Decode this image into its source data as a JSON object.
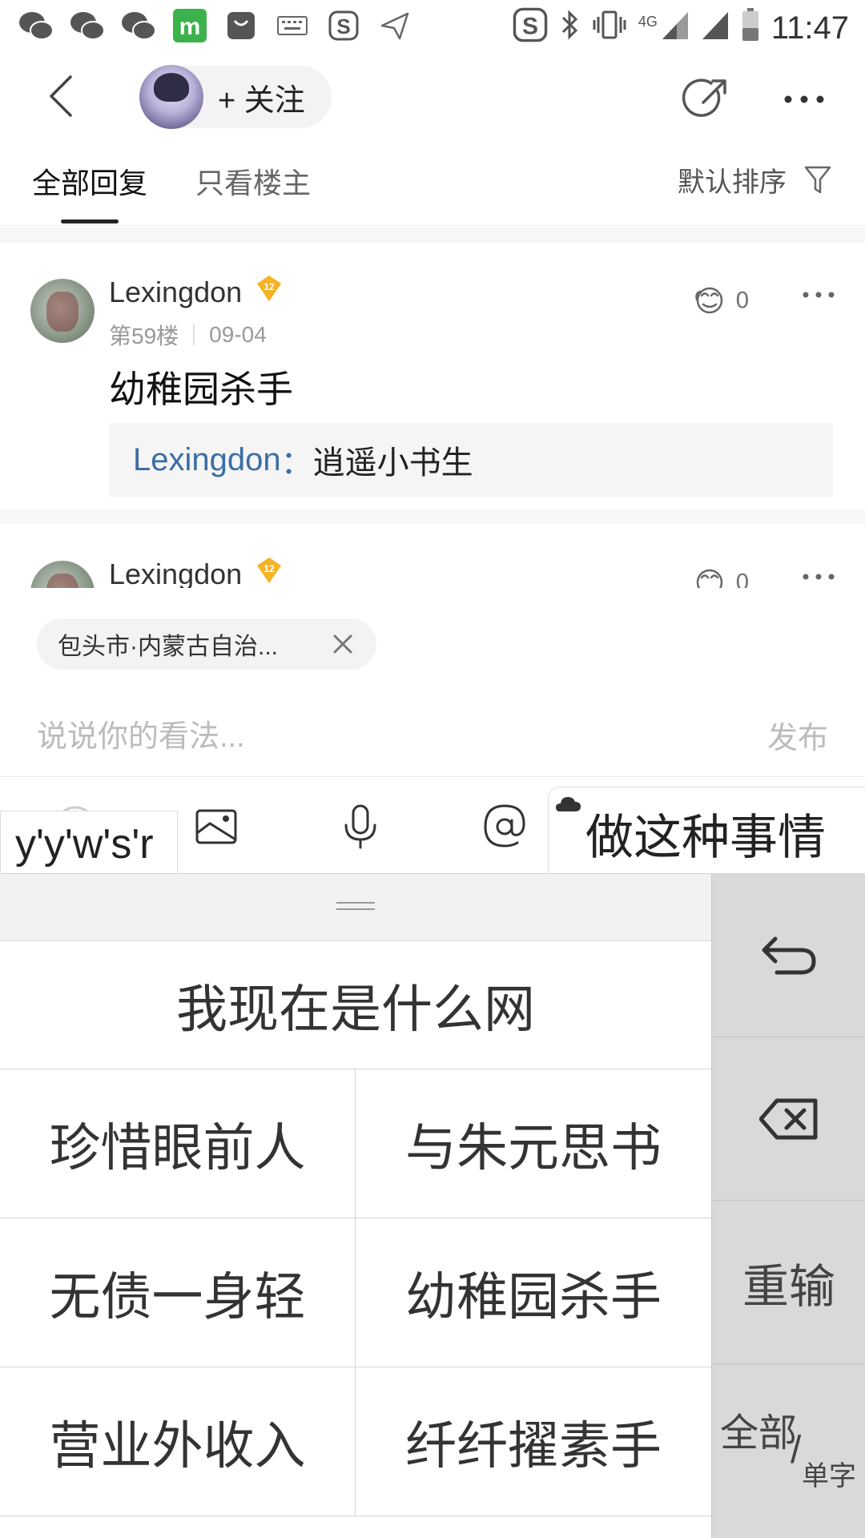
{
  "status_bar": {
    "time": "11:47",
    "network": "4G",
    "icons": [
      "wechat-icon",
      "wechat-icon",
      "wechat-icon",
      "app-m-icon",
      "app-bag-icon",
      "keyboard-icon",
      "sogou-icon",
      "send-icon",
      "sogou-icon",
      "bluetooth-icon",
      "vibrate-icon",
      "signal-icon",
      "signal-icon",
      "battery-icon"
    ]
  },
  "top_nav": {
    "follow_label": "+ 关注"
  },
  "tabs": {
    "all_replies": "全部回复",
    "owner_only": "只看楼主",
    "sort_label": "默认排序"
  },
  "posts": [
    {
      "username": "Lexingdon",
      "level": "12",
      "floor": "第59楼",
      "date": "09-04",
      "likes": "0",
      "content": "幼稚园杀手",
      "quote_author": "Lexingdon",
      "quote_sep": "：",
      "quote_text": "逍遥小书生"
    },
    {
      "username": "Lexingdon",
      "level": "12",
      "likes": "0"
    }
  ],
  "location_chip": {
    "label": "包头市·内蒙古自治..."
  },
  "comment": {
    "placeholder": "说说你的看法...",
    "publish_label": "发布"
  },
  "ime": {
    "pinyin": "y'y'w's'r",
    "candidate_bubble": "做这种事情",
    "full_candidate": "我现在是什么网",
    "candidates": [
      "珍惜眼前人",
      "与朱元思书",
      "无债一身轻",
      "幼稚园杀手",
      "营业外收入",
      "纤纤擢素手"
    ],
    "side_keys": {
      "reinput": "重输",
      "all": "全部",
      "slash": "/",
      "single": "单字"
    }
  },
  "colors": {
    "quote_author": "#3a6ea5",
    "level_badge": "#f5b324",
    "keyboard_side": "#d9d9d9"
  }
}
